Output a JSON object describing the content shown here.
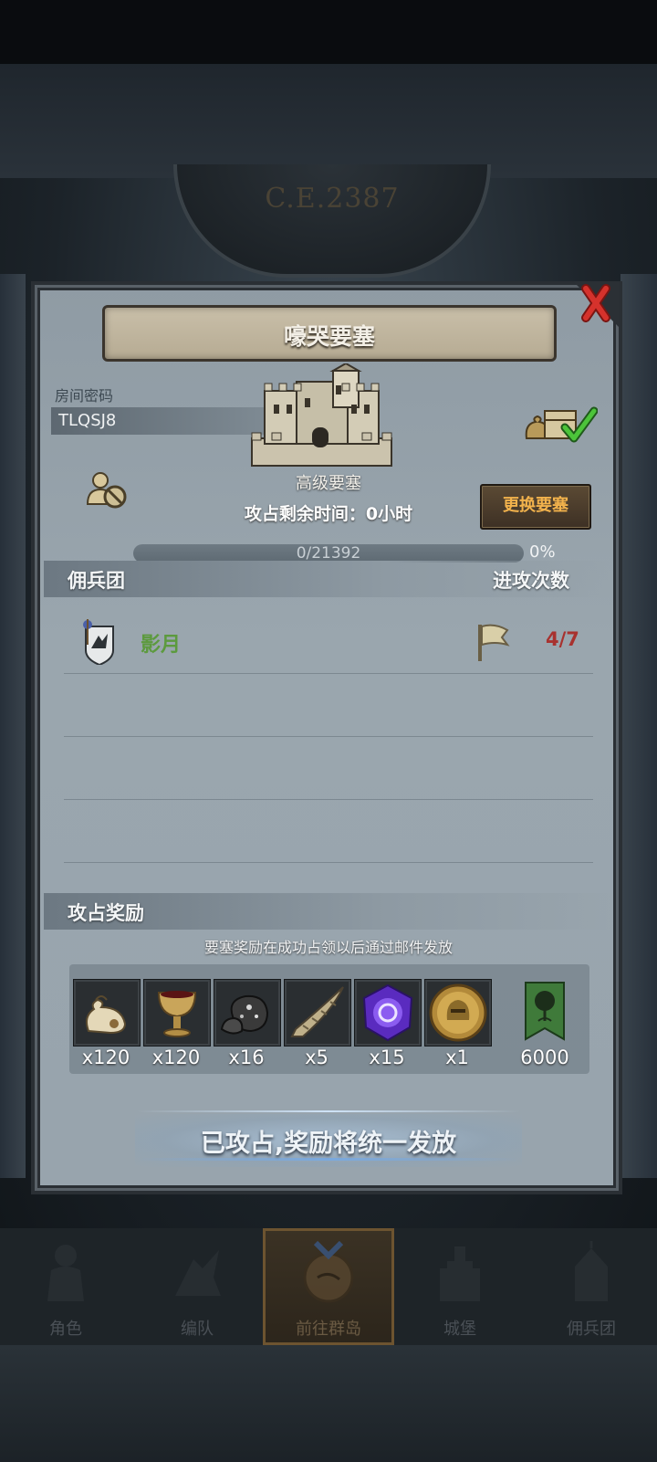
{
  "background": {
    "era_label": "C.E.2387"
  },
  "panel": {
    "title": "嚎哭要塞",
    "room_code_label": "房间密码",
    "room_code": "TLQSJ8",
    "fortress_level": "高级要塞",
    "time_remaining": "攻占剩余时间：0小时",
    "change_button": "更换要塞",
    "progress_text": "0/21392",
    "progress_percent": "0%",
    "progress_value": 0
  },
  "mercenary_section": {
    "label": "佣兵团",
    "attacks_label": "进攻次数",
    "rows": [
      {
        "name": "影月",
        "attacks": "4/7"
      }
    ]
  },
  "rewards": {
    "label": "攻占奖励",
    "note": "要塞奖励在成功占领以后通过邮件发放",
    "items": [
      {
        "icon": "sack-icon",
        "qty": "x120"
      },
      {
        "icon": "goblet-icon",
        "qty": "x120"
      },
      {
        "icon": "ore-icon",
        "qty": "x16"
      },
      {
        "icon": "horn-icon",
        "qty": "x5"
      },
      {
        "icon": "purple-gem-icon",
        "qty": "x15"
      },
      {
        "icon": "helmet-coin-icon",
        "qty": "x1"
      },
      {
        "icon": "tree-banner-icon",
        "qty": "6000"
      }
    ]
  },
  "status_message": "已攻占,奖励将统一发放",
  "nav": {
    "items": [
      {
        "label": "角色",
        "icon": "knight-icon"
      },
      {
        "label": "编队",
        "icon": "formation-icon"
      },
      {
        "label": "前往群岛",
        "icon": "islands-icon",
        "active": true
      },
      {
        "label": "城堡",
        "icon": "castle-icon"
      },
      {
        "label": "佣兵团",
        "icon": "mercenary-icon"
      }
    ]
  },
  "colors": {
    "accent_orange": "#f2b24c",
    "guild_green": "#5c9a3e",
    "attack_red": "#a8322f",
    "panel": "#98a4ad"
  }
}
